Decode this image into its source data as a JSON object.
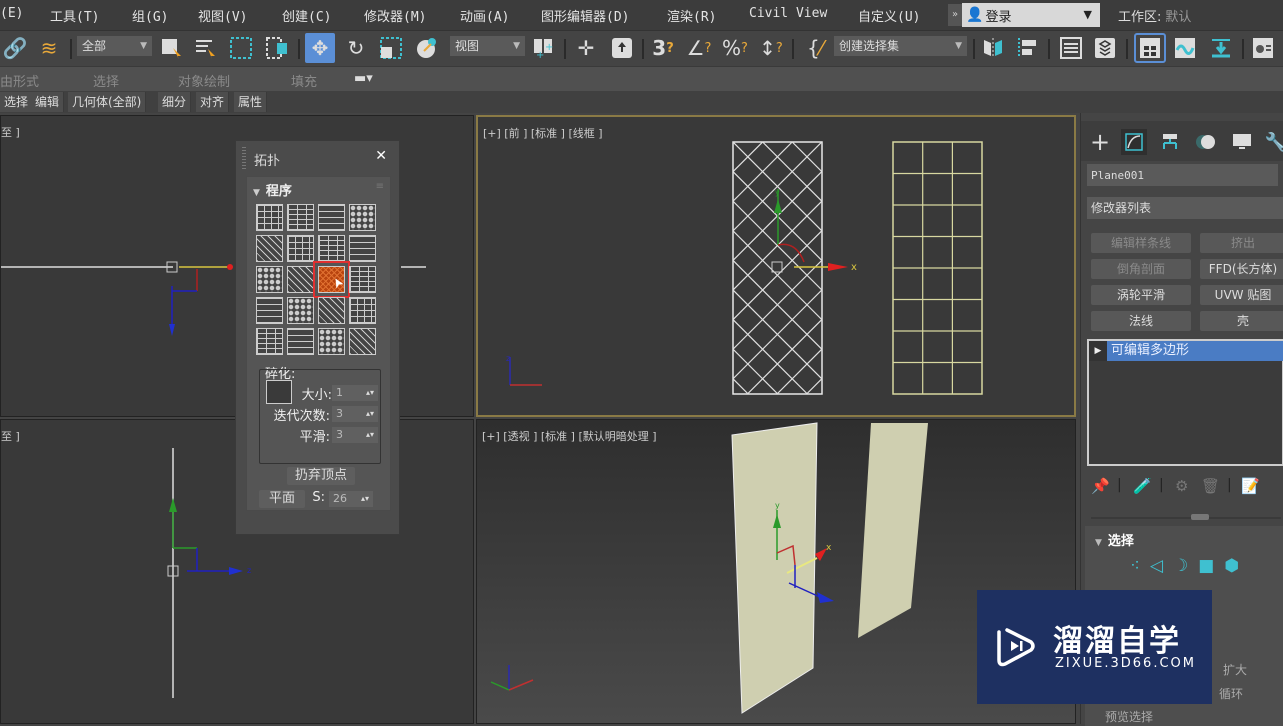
{
  "menubar": {
    "items": [
      "(E)",
      "工具(T)",
      "组(G)",
      "视图(V)",
      "创建(C)",
      "修改器(M)",
      "动画(A)",
      "图形编辑器(D)",
      "渲染(R)",
      "Civil View",
      "自定义(U)"
    ],
    "more": "»",
    "login": "登录",
    "workspace_label": "工作区:",
    "workspace_value": "默认"
  },
  "toolbar": {
    "filter_dropdown": "全部",
    "coord_dropdown": "视图",
    "selection_set_dropdown": "创建选择集",
    "snap_labels": [
      "3",
      "∠",
      "%",
      "↕"
    ]
  },
  "ribbon": {
    "groups": [
      "由形式",
      "选择",
      "对象绘制",
      "填充"
    ],
    "tabs": [
      "选择",
      "编辑",
      "几何体(全部)",
      "细分",
      "对齐",
      "属性"
    ]
  },
  "viewports": {
    "top_left": {
      "label": "至 ]"
    },
    "top_right": {
      "label": "[+] [前 ] [标准 ] [线框 ]"
    },
    "bottom_left": {
      "label": "至 ]"
    },
    "bottom_right": {
      "label": "[+] [透视 ] [标准 ] [默认明暗处理 ]"
    },
    "axis_labels": {
      "x": "x",
      "y": "y",
      "z": "z"
    }
  },
  "topology_caddy": {
    "title": "拓扑",
    "close": "✕",
    "rollout_title": "程序",
    "pattern_count": 20,
    "selected_pattern_index": 10,
    "fragment": {
      "label": "碎化:",
      "size_label": "大小:",
      "size_value": "1",
      "iterations_label": "迭代次数:",
      "iterations_value": "3",
      "smooth_label": "平滑:",
      "smooth_value": "3"
    },
    "discard_vertices": "扔弃顶点",
    "plane_button": "平面",
    "s_label": "S:",
    "s_value": "26"
  },
  "command_panel": {
    "object_name": "Plane001",
    "modifier_list": "修改器列表",
    "modifier_buttons": [
      {
        "label": "编辑样条线",
        "enabled": false
      },
      {
        "label": "挤出",
        "enabled": false
      },
      {
        "label": "倒角剖面",
        "enabled": false
      },
      {
        "label": "FFD(长方体)",
        "enabled": true
      },
      {
        "label": "涡轮平滑",
        "enabled": true
      },
      {
        "label": "UVW 贴图",
        "enabled": true
      },
      {
        "label": "法线",
        "enabled": true
      },
      {
        "label": "壳",
        "enabled": true
      }
    ],
    "stack_items": [
      "可编辑多边形"
    ],
    "selection_rollout": "选择",
    "hidden_labels": [
      "扩大",
      "循环",
      "预览选择"
    ]
  },
  "watermark": {
    "title": "溜溜自学",
    "url": "ZIXUE.3D66.COM"
  },
  "colors": {
    "accent_blue": "#4a7cc4",
    "active_viewport_border": "#8a7a45",
    "cyan_icon": "#3fc0d0",
    "selection_red": "#e03030",
    "plane_fill": "#cfcfb0"
  }
}
